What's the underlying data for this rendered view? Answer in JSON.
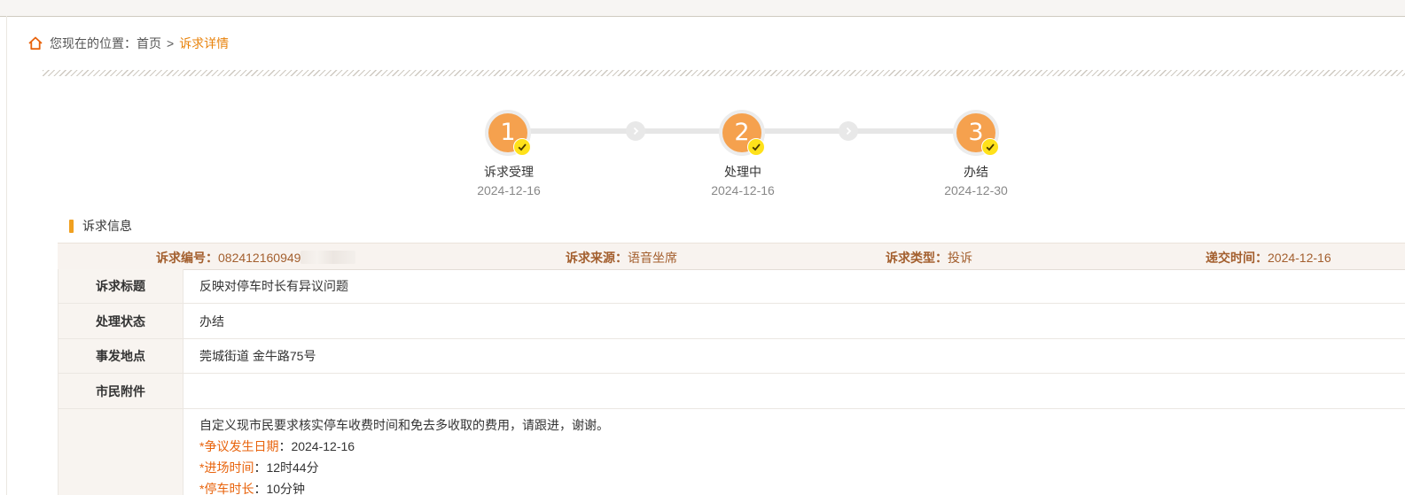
{
  "breadcrumb": {
    "prefix": "您现在的位置：",
    "home": "首页",
    "separator": ">",
    "current": "诉求详情"
  },
  "progress": {
    "steps": [
      {
        "number": "1",
        "label": "诉求受理",
        "date": "2024-12-16",
        "done": true
      },
      {
        "number": "2",
        "label": "处理中",
        "date": "2024-12-16",
        "done": true
      },
      {
        "number": "3",
        "label": "办结",
        "date": "2024-12-30",
        "done": true
      }
    ]
  },
  "section": {
    "title": "诉求信息"
  },
  "info": {
    "number_label": "诉求编号：",
    "number_value": "082412160949",
    "source_label": "诉求来源：",
    "source_value": "语音坐席",
    "type_label": "诉求类型：",
    "type_value": "投诉",
    "time_label": "递交时间：",
    "time_value": "2024-12-16"
  },
  "details": {
    "title_label": "诉求标题",
    "title_value": "反映对停车时长有异议问题",
    "status_label": "处理状态",
    "status_value": "办结",
    "location_label": "事发地点",
    "location_value": "莞城街道 金牛路75号",
    "attachment_label": "市民附件",
    "attachment_value": ""
  },
  "description": {
    "text": "自定义现市民要求核实停车收费时间和免去多收取的费用，请跟进，谢谢。",
    "fields": [
      {
        "label": "*争议发生日期",
        "sep": "：",
        "value": "2024-12-16"
      },
      {
        "label": "*进场时间",
        "sep": "：",
        "value": "12时44分"
      },
      {
        "label": "*停车时长",
        "sep": "：",
        "value": "10分钟"
      }
    ]
  },
  "colors": {
    "accent": "#e8830c",
    "step_fill": "#f5a14e",
    "check": "#ffe11a",
    "info_text": "#a35f2e"
  }
}
